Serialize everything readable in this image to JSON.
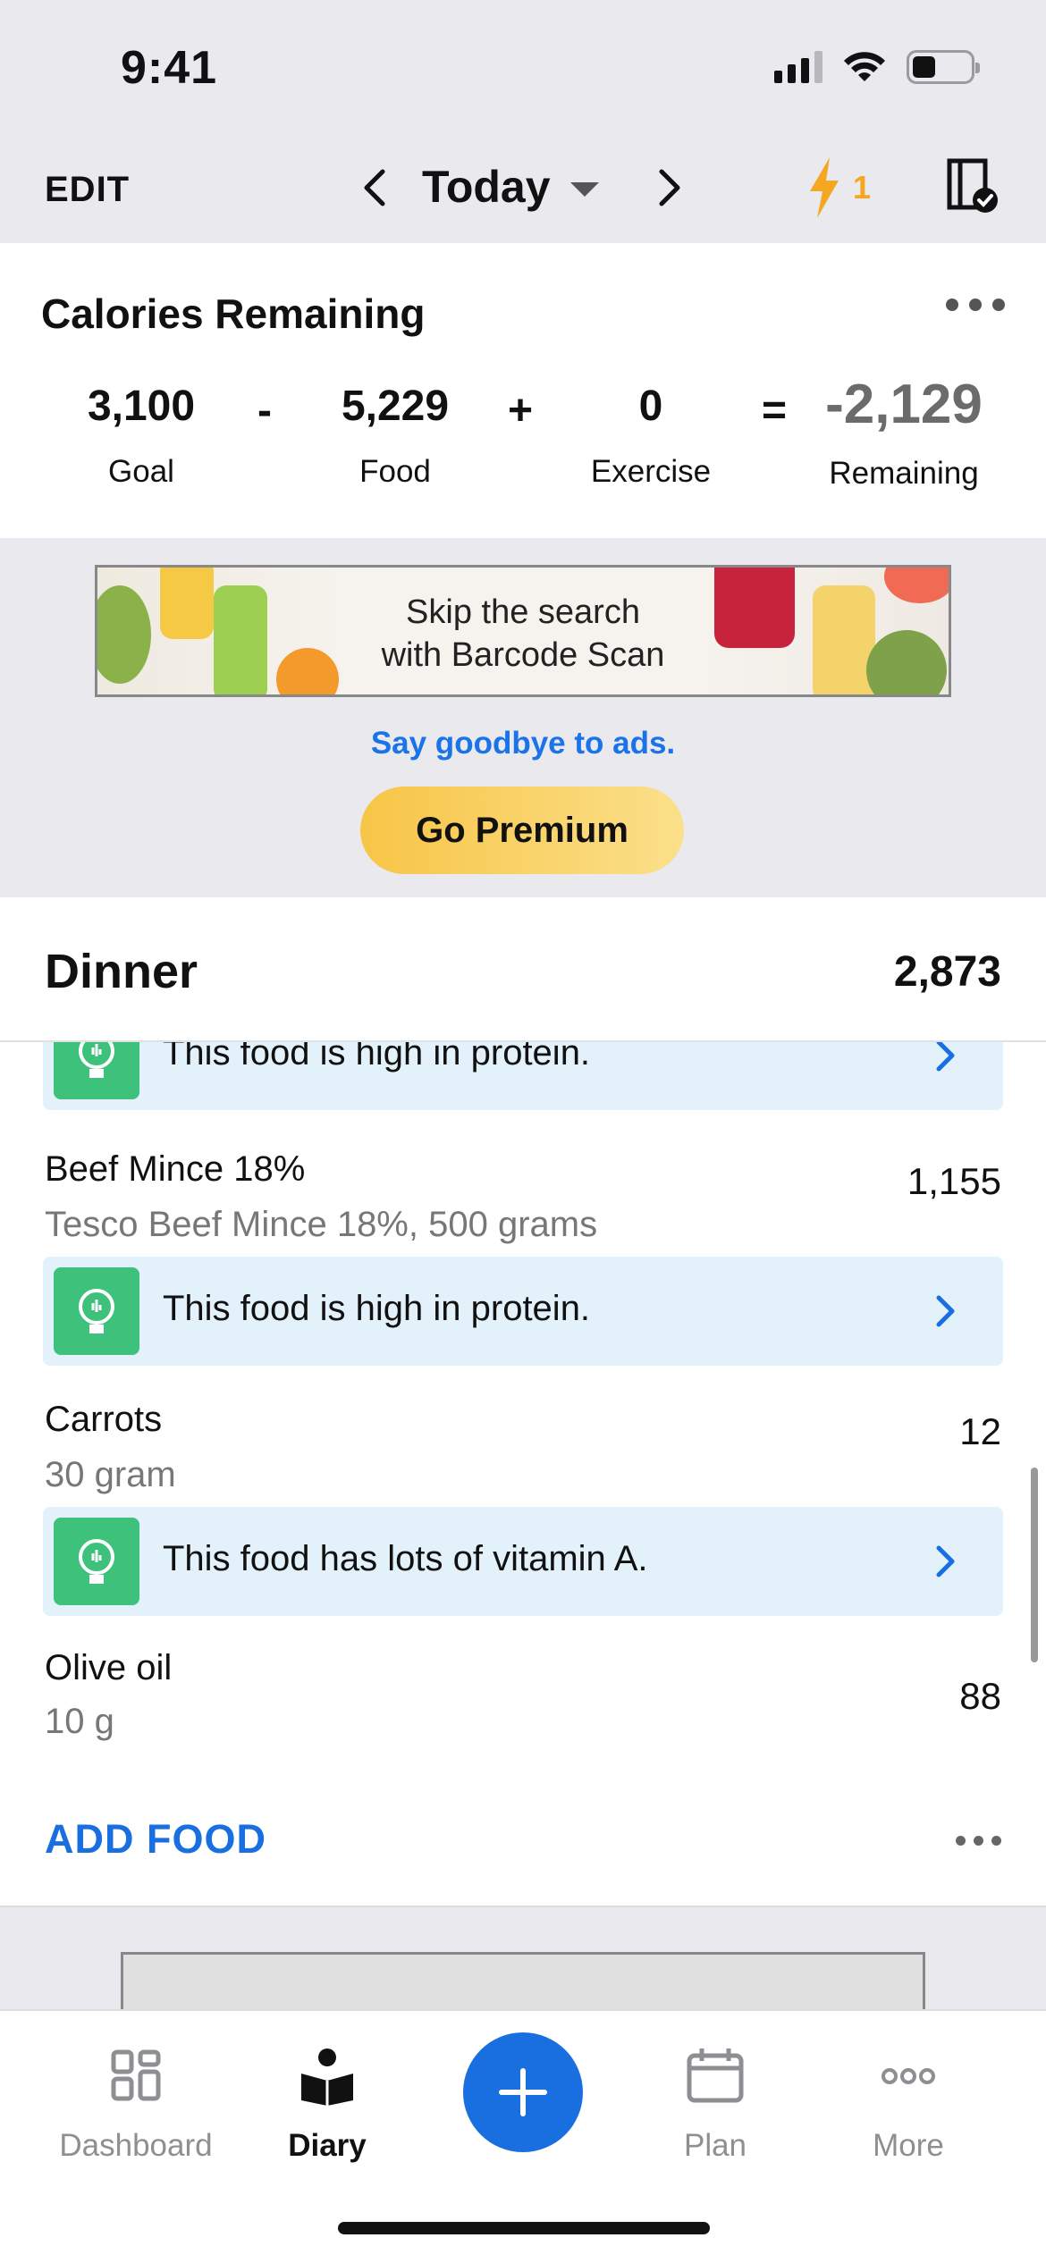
{
  "status_bar": {
    "time": "9:41"
  },
  "top_nav": {
    "edit_label": "EDIT",
    "date_label": "Today",
    "streak_count": "1"
  },
  "calories": {
    "title": "Calories Remaining",
    "goal_value": "3,100",
    "goal_label": "Goal",
    "minus": "-",
    "food_value": "5,229",
    "food_label": "Food",
    "plus": "+",
    "exercise_value": "0",
    "exercise_label": "Exercise",
    "equals": "=",
    "remaining_value": "-2,129",
    "remaining_label": "Remaining"
  },
  "ad": {
    "banner_line1": "Skip the search",
    "banner_line2": "with Barcode Scan",
    "goodbye_link": "Say goodbye to ads.",
    "premium_button": "Go Premium"
  },
  "dinner": {
    "title": "Dinner",
    "total": "2,873",
    "tips": [
      {
        "text": "This food is high in protein."
      },
      {
        "text": "This food is high in protein."
      },
      {
        "text": "This food has lots of vitamin A."
      }
    ],
    "foods": [
      {
        "name": "Beef Mince 18%",
        "detail": "Tesco Beef Mince 18%, 500 grams",
        "calories": "1,155"
      },
      {
        "name": "Carrots",
        "detail": "30 gram",
        "calories": "12"
      },
      {
        "name": "Olive oil",
        "detail": "10 g",
        "calories": "88"
      }
    ],
    "add_food_label": "ADD FOOD"
  },
  "tab_bar": {
    "tabs": [
      {
        "label": "Dashboard",
        "icon": "dashboard-grid-icon"
      },
      {
        "label": "Diary",
        "icon": "diary-book-icon"
      },
      {
        "label": "Plan",
        "icon": "calendar-icon"
      },
      {
        "label": "More",
        "icon": "more-dots-icon"
      }
    ],
    "add_icon": "plus-icon"
  },
  "colors": {
    "accent_blue": "#1a6fe0",
    "tip_green": "#3ec27b",
    "tip_bg": "#e3f1fb",
    "streak_orange": "#f5a623",
    "premium_gold": "#f7c547"
  }
}
